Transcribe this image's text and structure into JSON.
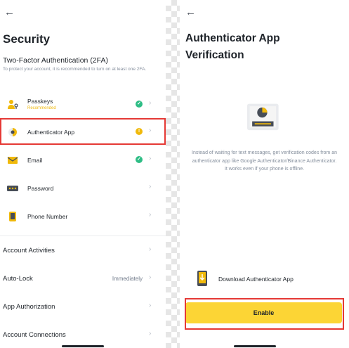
{
  "security": {
    "back_icon": "arrow-left-icon",
    "title": "Security",
    "twofa_title": "Two-Factor Authentication (2FA)",
    "twofa_desc": "To protect your account, it is recommended to turn on at least one 2FA.",
    "methods": [
      {
        "label": "Passkeys",
        "badge": "Recommended",
        "icon": "passkeys-icon",
        "status": "enabled"
      },
      {
        "label": "Authenticator App",
        "icon": "authenticator-icon",
        "status": "warning"
      },
      {
        "label": "Email",
        "icon": "email-icon",
        "status": "enabled"
      },
      {
        "label": "Password",
        "icon": "password-icon",
        "status": "none"
      },
      {
        "label": "Phone Number",
        "icon": "phone-icon",
        "status": "none"
      }
    ],
    "settings": [
      {
        "label": "Account Activities",
        "value": ""
      },
      {
        "label": "Auto-Lock",
        "value": "Immediately"
      },
      {
        "label": "App Authorization",
        "value": ""
      },
      {
        "label": "Account Connections",
        "value": ""
      }
    ]
  },
  "authenticator": {
    "back_icon": "arrow-left-icon",
    "title_line1": "Authenticator App",
    "title_line2": "Verification",
    "description": "Instead of waiting for text messages, get verification codes from an authenticator app like Google Authenticator/Binance Authenticator. It works even if your phone is offline.",
    "download_label": "Download Authenticator App",
    "enable_label": "Enable"
  },
  "colors": {
    "accent": "#fcd535",
    "brand": "#f0b90b",
    "success": "#2ebd85",
    "highlight": "#e53935",
    "text": "#1e2329",
    "muted": "#848e9c"
  }
}
